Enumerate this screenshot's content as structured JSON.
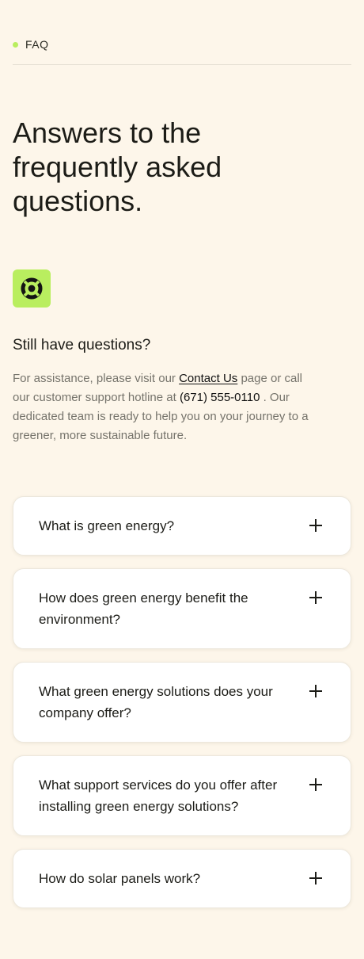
{
  "eyebrow": {
    "label": "FAQ"
  },
  "headline": "Answers to the frequently asked questions.",
  "support": {
    "icon": "lifebuoy-icon",
    "title": "Still have questions?",
    "text_before": "For assistance, please visit our ",
    "contact_link": "Contact Us",
    "text_middle": " page or call our customer support hotline at ",
    "phone": "(671) 555-0110",
    "text_after": " . Our dedicated team is ready to help you on your journey to a greener, more sustainable future."
  },
  "faq": {
    "items": [
      {
        "question": "What is green energy?"
      },
      {
        "question": "How does green energy benefit the environment?"
      },
      {
        "question": "What green energy solutions does your company offer?"
      },
      {
        "question": "What support services do you offer after installing green energy solutions?"
      },
      {
        "question": "How do solar panels work?"
      }
    ]
  },
  "colors": {
    "background": "#fdf6ea",
    "accent": "#b9ee5f",
    "text": "#1c1c17",
    "muted_text": "#75736b"
  }
}
